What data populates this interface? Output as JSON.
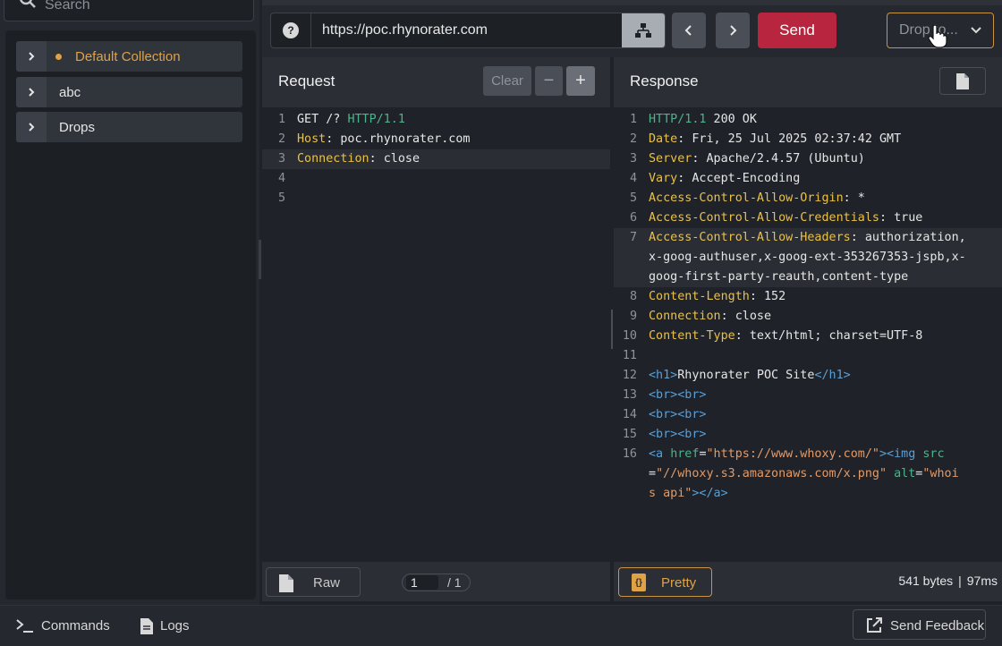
{
  "sidebar": {
    "search_placeholder": "Search",
    "collections": [
      {
        "label": "Default Collection",
        "active": true
      },
      {
        "label": "abc"
      },
      {
        "label": "Drops"
      }
    ]
  },
  "topbar": {
    "help_glyph": "?",
    "url": "https://poc.rhynorater.com",
    "send_label": "Send",
    "drop_label": "Drop to...",
    "accent_send": "#b8253f",
    "accent_drop": "#c9953e"
  },
  "request": {
    "title": "Request",
    "clear_label": "Clear",
    "minus_label": "−",
    "plus_label": "+",
    "lines": [
      {
        "n": "1",
        "segments": [
          {
            "t": "GET /? ",
            "c": ""
          },
          {
            "t": "HTTP/1.1",
            "c": "g"
          }
        ]
      },
      {
        "n": "2",
        "segments": [
          {
            "t": "Host",
            "c": "k"
          },
          {
            "t": ": poc.rhynorater.com",
            "c": ""
          }
        ]
      },
      {
        "n": "3",
        "segments": [
          {
            "t": "Connection",
            "c": "k"
          },
          {
            "t": ": close",
            "c": ""
          }
        ],
        "highlight": true
      },
      {
        "n": "4",
        "segments": []
      },
      {
        "n": "5",
        "segments": []
      }
    ],
    "raw_label": "Raw",
    "page_current": "1",
    "page_total": "/ 1"
  },
  "response": {
    "title": "Response",
    "lines": [
      {
        "n": "1",
        "segments": [
          {
            "t": "HTTP/1.1",
            "c": "g"
          },
          {
            "t": " 200 OK",
            "c": ""
          }
        ]
      },
      {
        "n": "2",
        "segments": [
          {
            "t": "Date",
            "c": "k"
          },
          {
            "t": ": Fri, 25 Jul 2025 02:37:42 GMT",
            "c": ""
          }
        ]
      },
      {
        "n": "3",
        "segments": [
          {
            "t": "Server",
            "c": "k"
          },
          {
            "t": ": Apache/2.4.57 (Ubuntu)",
            "c": ""
          }
        ]
      },
      {
        "n": "4",
        "segments": [
          {
            "t": "Vary",
            "c": "k"
          },
          {
            "t": ": Accept-Encoding",
            "c": ""
          }
        ]
      },
      {
        "n": "5",
        "segments": [
          {
            "t": "Access-Control-Allow-Origin",
            "c": "k"
          },
          {
            "t": ": *",
            "c": ""
          }
        ]
      },
      {
        "n": "6",
        "segments": [
          {
            "t": "Access-Control-Allow-Credentials",
            "c": "k"
          },
          {
            "t": ": true",
            "c": ""
          }
        ]
      },
      {
        "n": "7",
        "segments": [
          {
            "t": "Access-Control-Allow-Headers",
            "c": "k"
          },
          {
            "t": ": authorization,",
            "c": ""
          }
        ],
        "highlight": true
      },
      {
        "n": "",
        "segments": [
          {
            "t": "x-goog-authuser,x-goog-ext-353267353-jspb,x-",
            "c": ""
          }
        ],
        "highlight": true
      },
      {
        "n": "",
        "segments": [
          {
            "t": "goog-first-party-reauth,content-type",
            "c": ""
          }
        ],
        "highlight": true
      },
      {
        "n": "8",
        "segments": [
          {
            "t": "Content-Length",
            "c": "k"
          },
          {
            "t": ": 152",
            "c": ""
          }
        ]
      },
      {
        "n": "9",
        "segments": [
          {
            "t": "Connection",
            "c": "k"
          },
          {
            "t": ": close",
            "c": ""
          }
        ]
      },
      {
        "n": "10",
        "segments": [
          {
            "t": "Content-Type",
            "c": "k"
          },
          {
            "t": ": text/html; charset=UTF-8",
            "c": ""
          }
        ]
      },
      {
        "n": "11",
        "segments": []
      },
      {
        "n": "12",
        "segments": [
          {
            "t": "<h1>",
            "c": "tag"
          },
          {
            "t": "Rhynorater POC Site",
            "c": ""
          },
          {
            "t": "</h1>",
            "c": "tag"
          }
        ]
      },
      {
        "n": "13",
        "segments": [
          {
            "t": "<br><br>",
            "c": "tag"
          }
        ]
      },
      {
        "n": "14",
        "segments": [
          {
            "t": "<br><br>",
            "c": "tag"
          }
        ]
      },
      {
        "n": "15",
        "segments": [
          {
            "t": "<br><br>",
            "c": "tag"
          }
        ]
      },
      {
        "n": "16",
        "segments": [
          {
            "t": "<a ",
            "c": "tag"
          },
          {
            "t": "href",
            "c": "attr"
          },
          {
            "t": "=",
            "c": ""
          },
          {
            "t": "\"https://www.whoxy.com/\"",
            "c": "str"
          },
          {
            "t": "><img ",
            "c": "tag"
          },
          {
            "t": "src",
            "c": "attr"
          }
        ]
      },
      {
        "n": "",
        "segments": [
          {
            "t": "=",
            "c": ""
          },
          {
            "t": "\"//whoxy.s3.amazonaws.com/x.png\"",
            "c": "str"
          },
          {
            "t": " alt",
            "c": "attr"
          },
          {
            "t": "=",
            "c": ""
          },
          {
            "t": "\"whoi",
            "c": "str"
          }
        ]
      },
      {
        "n": "",
        "segments": [
          {
            "t": "s api\"",
            "c": "str"
          },
          {
            "t": "></a>",
            "c": "tag"
          }
        ]
      }
    ],
    "pretty_label": "Pretty",
    "pretty_glyph": "{}",
    "size": "541 bytes",
    "separator": "|",
    "time": "97ms"
  },
  "bottombar": {
    "commands_label": "Commands",
    "logs_label": "Logs",
    "feedback_label": "Send Feedback"
  }
}
